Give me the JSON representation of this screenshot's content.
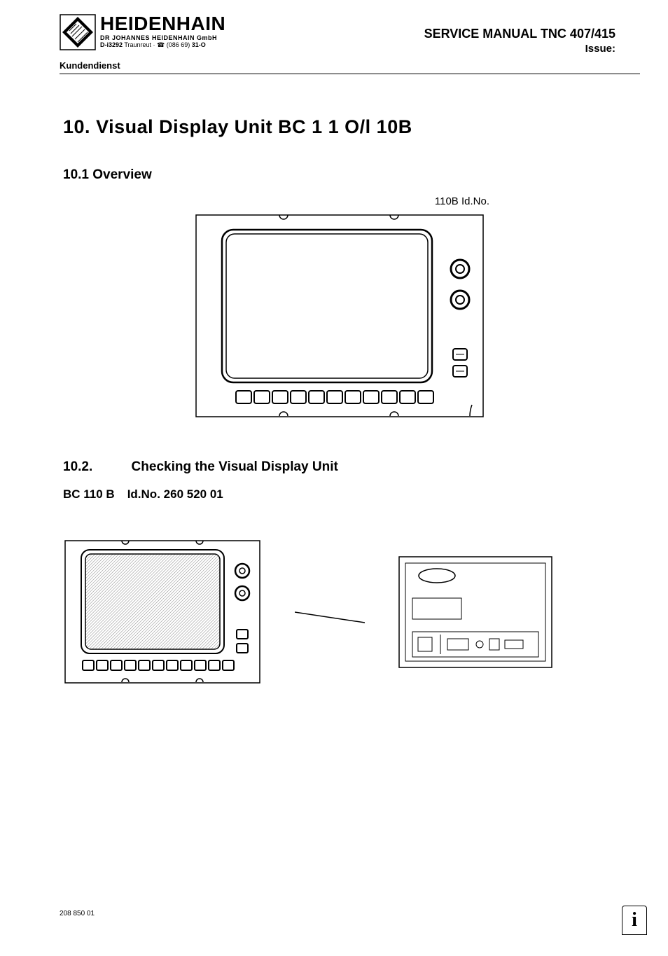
{
  "header": {
    "company_name": "HEIDENHAIN",
    "company_sub": "DR JOHANNES HEIDENHAIN GmbH",
    "company_addr_bold1": "D-i3292",
    "company_addr_plain": " Traunreut · ☎ (086 69) ",
    "company_addr_bold2": "31-O",
    "manual_title": "SERVICE MANUAL TNC 407/415",
    "manual_issue": "Issue:",
    "kundendienst": "Kundendienst"
  },
  "section10": {
    "num": "10.",
    "title": "Visual Display Unit BC 1 1 O/l 10B"
  },
  "section10_1": {
    "num": "10.1",
    "title": "Overview",
    "id_label": "110B   Id.No."
  },
  "section10_2": {
    "num": "10.2.",
    "title": "Checking the Visual Display Unit",
    "device": "BC 110 B",
    "idno_label": "Id.No.",
    "idno_val": "260 520 01"
  },
  "footer": {
    "num": "208 850 01"
  }
}
